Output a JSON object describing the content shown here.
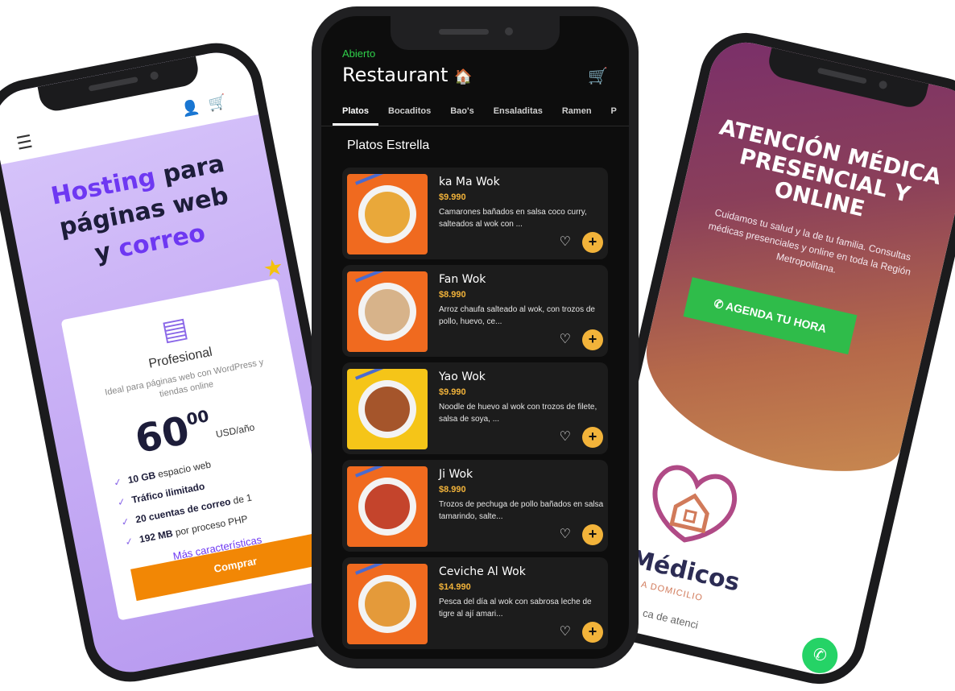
{
  "hosting": {
    "title_accent_1": "Hosting",
    "title_rest_1": " para",
    "title_line_2": "páginas web",
    "title_rest_3": "y ",
    "title_accent_3": "correo",
    "plan_name": "Profesional",
    "plan_desc": "Ideal para páginas web con WordPress y tiendas online",
    "price_main": "60",
    "price_cents": "00",
    "price_unit": "USD/año",
    "features": [
      {
        "bold": "10 GB",
        "rest": " espacio web"
      },
      {
        "bold": "Tráfico ilimitado",
        "rest": ""
      },
      {
        "bold": "20 cuentas de correo",
        "rest": " de 1"
      },
      {
        "bold": "192 MB",
        "rest": " por proceso PHP"
      }
    ],
    "more_label": "Más características",
    "buy_label": "Comprar",
    "icons": [
      "menu-icon",
      "user-icon",
      "cart-icon",
      "star-icon",
      "layers-icon",
      "check-icon"
    ]
  },
  "restaurant": {
    "status": "Abierto",
    "title": "Restaurant",
    "tabs": [
      "Platos",
      "Bocaditos",
      "Bao's",
      "Ensaladitas",
      "Ramen",
      "P"
    ],
    "section_title": "Platos Estrella",
    "items": [
      {
        "name": "ka Ma Wok",
        "price": "$9.990",
        "desc": "Camarones bañados en salsa coco curry, salteados al wok con ...",
        "bg": "#f06a1f",
        "food": "#e9a83a"
      },
      {
        "name": "Fan Wok",
        "price": "$8.990",
        "desc": "Arroz chaufa salteado al wok, con trozos de pollo, huevo, ce...",
        "bg": "#f06a1f",
        "food": "#d7b38a"
      },
      {
        "name": "Yao Wok",
        "price": "$9.990",
        "desc": "Noodle de huevo al wok con trozos de filete, salsa de soya, ...",
        "bg": "#f5c518",
        "food": "#a5552b"
      },
      {
        "name": "Ji Wok",
        "price": "$8.990",
        "desc": "Trozos de pechuga de pollo bañados en salsa tamarindo, salte...",
        "bg": "#f06a1f",
        "food": "#c4442c"
      },
      {
        "name": "Ceviche Al Wok",
        "price": "$14.990",
        "desc": "Pesca del día al wok con sabrosa leche de tigre al ají amari...",
        "bg": "#f06a1f",
        "food": "#e49a3a"
      }
    ],
    "icons": [
      "cart-icon",
      "heart-icon",
      "plus-icon",
      "house-icon"
    ],
    "accent_color": "#f2b33a",
    "status_color": "#2fd04a"
  },
  "medical": {
    "title": "ATENCIÓN MÉDICA PRESENCIAL Y ONLINE",
    "subtitle": "Cuidamos tu salud y la de tu familia. Consultas médicas presenciales y online en toda la Región Metropolitana.",
    "cta_label": "AGENDA TU HORA",
    "brand": "Médicos",
    "tagline": "A DOMICILIO",
    "body_text": "ca  de  atenci",
    "icons": [
      "whatsapp-icon",
      "stethoscope-house-logo"
    ],
    "cta_color": "#2fbc4a"
  }
}
